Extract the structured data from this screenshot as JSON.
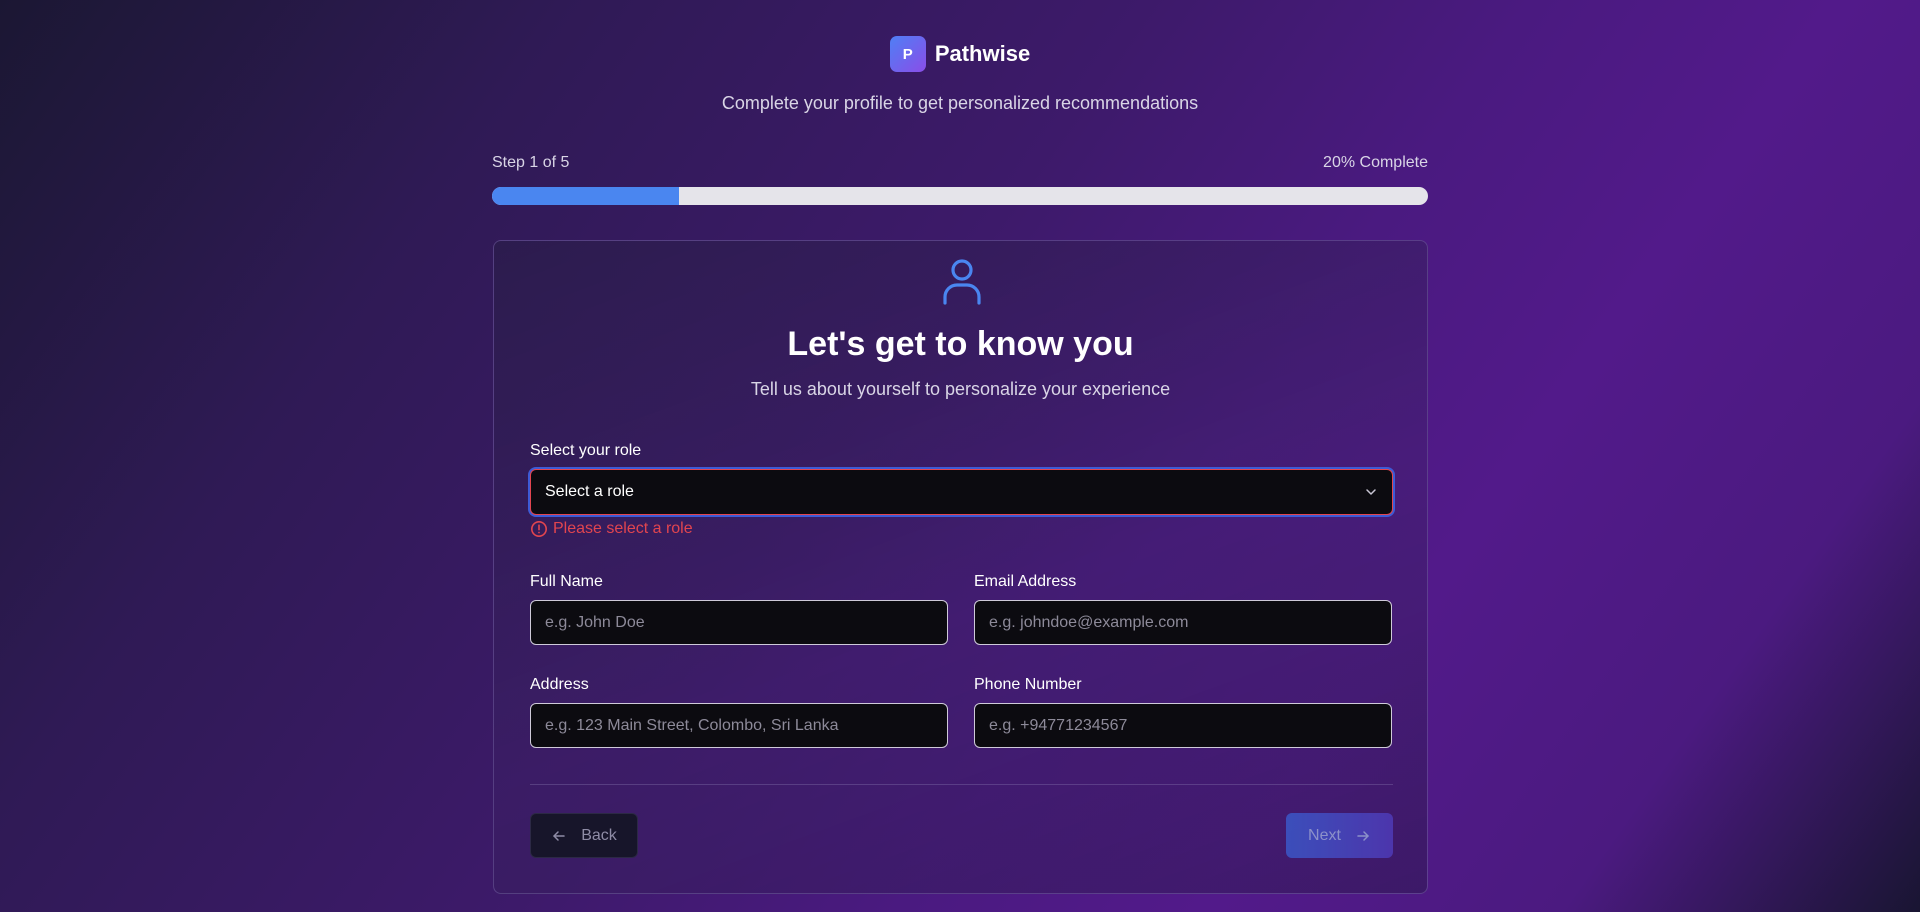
{
  "brand": {
    "logo_letter": "P",
    "name": "Pathwise"
  },
  "tagline": "Complete your profile to get personalized recommendations",
  "progress": {
    "step_label": "Step 1 of 5",
    "percent_label": "20% Complete",
    "fraction": 0.2,
    "fill_color": "#4a86f0"
  },
  "card": {
    "icon": "user-icon",
    "title": "Let's get to know you",
    "subtitle": "Tell us about yourself to personalize your experience"
  },
  "form": {
    "role": {
      "label": "Select your role",
      "value": "Select a role",
      "error": "Please select a role"
    },
    "full_name": {
      "label": "Full Name",
      "placeholder": "e.g. John Doe"
    },
    "email": {
      "label": "Email Address",
      "placeholder": "e.g. johndoe@example.com"
    },
    "address": {
      "label": "Address",
      "placeholder": "e.g. 123 Main Street, Colombo, Sri Lanka"
    },
    "phone": {
      "label": "Phone Number",
      "placeholder": "e.g. +94771234567"
    }
  },
  "buttons": {
    "back": "Back",
    "next": "Next"
  },
  "colors": {
    "error": "#e2454f",
    "accent": "#4a86f0"
  }
}
